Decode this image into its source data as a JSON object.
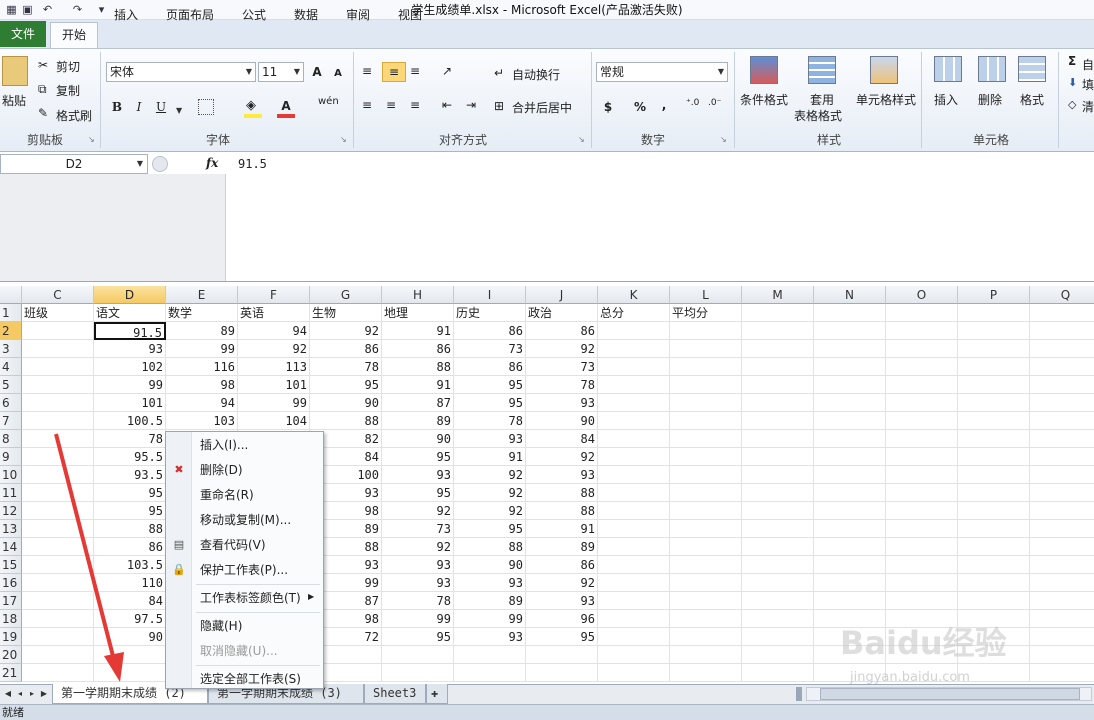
{
  "window": {
    "title": "学生成绩单.xlsx  -  Microsoft Excel(产品激活失败)"
  },
  "ribbon_tabs": [
    "文件",
    "开始",
    "插入",
    "页面布局",
    "公式",
    "数据",
    "审阅",
    "视图"
  ],
  "clipboard": {
    "paste": "粘贴",
    "cut": "剪切",
    "copy": "复制",
    "format_painter": "格式刷",
    "label": "剪贴板"
  },
  "font": {
    "name": "宋体",
    "size": "11",
    "label": "字体",
    "bold": "B",
    "italic": "I",
    "underline": "U",
    "grow": "A",
    "shrink": "A",
    "color": "A",
    "phonetic": "wén"
  },
  "alignment": {
    "wrap": "自动换行",
    "merge": "合并后居中",
    "label": "对齐方式"
  },
  "number": {
    "format": "常规",
    "currency": "$",
    "percent": "%",
    "comma": ",",
    "label": "数字"
  },
  "styles": {
    "conditional": "条件格式",
    "table": "套用",
    "table2": "表格格式",
    "cell": "单元格样式",
    "label": "样式"
  },
  "cells": {
    "insert": "插入",
    "delete": "删除",
    "format": "格式",
    "label": "单元格"
  },
  "editing": {
    "sum": "Σ",
    "fill": "填",
    "clear": "清",
    "sum_text": "自"
  },
  "formula_bar": {
    "name_box": "D2",
    "fx": "fx",
    "value": "91.5"
  },
  "columns": [
    "C",
    "D",
    "E",
    "F",
    "G",
    "H",
    "I",
    "J",
    "K",
    "L",
    "M",
    "N",
    "O",
    "P",
    "Q"
  ],
  "rows": [
    "1",
    "2",
    "3",
    "4",
    "5",
    "6",
    "7",
    "8",
    "9",
    "10",
    "11",
    "12",
    "13",
    "14",
    "15",
    "16",
    "17",
    "18",
    "19",
    "20",
    "21"
  ],
  "headers": [
    "班级",
    "语文",
    "数学",
    "英语",
    "生物",
    "地理",
    "历史",
    "政治",
    "总分",
    "平均分"
  ],
  "data": [
    [
      "91.5",
      "89",
      "94",
      "92",
      "91",
      "86",
      "86"
    ],
    [
      "93",
      "99",
      "92",
      "86",
      "86",
      "73",
      "92"
    ],
    [
      "102",
      "116",
      "113",
      "78",
      "88",
      "86",
      "73"
    ],
    [
      "99",
      "98",
      "101",
      "95",
      "91",
      "95",
      "78"
    ],
    [
      "101",
      "94",
      "99",
      "90",
      "87",
      "95",
      "93"
    ],
    [
      "100.5",
      "103",
      "104",
      "88",
      "89",
      "78",
      "90"
    ],
    [
      "78",
      "",
      "",
      "82",
      "90",
      "93",
      "84"
    ],
    [
      "95.5",
      "",
      "",
      "84",
      "95",
      "91",
      "92"
    ],
    [
      "93.5",
      "",
      "",
      "100",
      "93",
      "92",
      "93"
    ],
    [
      "95",
      "",
      "",
      "93",
      "95",
      "92",
      "88"
    ],
    [
      "95",
      "",
      "",
      "98",
      "92",
      "92",
      "88"
    ],
    [
      "88",
      "",
      "",
      "89",
      "73",
      "95",
      "91"
    ],
    [
      "86",
      "",
      "",
      "88",
      "92",
      "88",
      "89"
    ],
    [
      "103.5",
      "",
      "",
      "93",
      "93",
      "90",
      "86"
    ],
    [
      "110",
      "",
      "",
      "99",
      "93",
      "93",
      "92"
    ],
    [
      "84",
      "",
      "",
      "87",
      "78",
      "89",
      "93"
    ],
    [
      "97.5",
      "",
      "",
      "98",
      "99",
      "99",
      "96"
    ],
    [
      "90",
      "",
      "",
      "72",
      "95",
      "93",
      "95"
    ]
  ],
  "context_menu": [
    {
      "label": "插入(I)...",
      "icon": ""
    },
    {
      "label": "删除(D)",
      "icon": "delete-sheet-icon"
    },
    {
      "label": "重命名(R)",
      "icon": ""
    },
    {
      "label": "移动或复制(M)...",
      "icon": ""
    },
    {
      "label": "查看代码(V)",
      "icon": "view-code-icon"
    },
    {
      "label": "保护工作表(P)...",
      "icon": "protect-sheet-icon"
    },
    {
      "label": "工作表标签颜色(T)",
      "icon": ""
    },
    {
      "label": "隐藏(H)",
      "icon": ""
    },
    {
      "label": "取消隐藏(U)...",
      "icon": ""
    },
    {
      "label": "选定全部工作表(S)",
      "icon": ""
    }
  ],
  "sheet_tabs": [
    "第一学期期末成绩 (2)",
    "第一学期期末成绩 (3)",
    "Sheet3"
  ],
  "status": "就绪",
  "watermark": {
    "text": "Baidu经验",
    "url": "jingyan.baidu.com"
  },
  "colors": {
    "accent": "#2e7d32",
    "selection": "#f5c963",
    "annotation": "#e53935"
  }
}
